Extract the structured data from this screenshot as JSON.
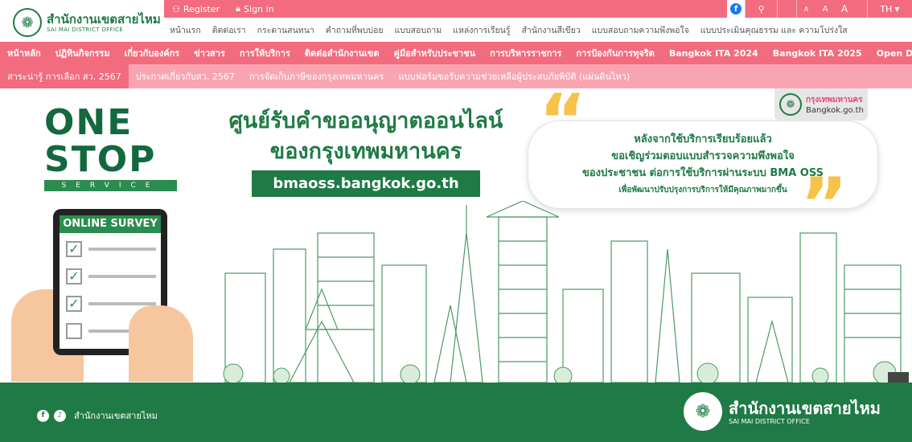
{
  "logo": {
    "seal_icon": "bma-seal-icon",
    "name_th": "สำนักงานเขตสายไหม",
    "name_en": "SAI MAI DISTRICT OFFICE"
  },
  "util_bar": {
    "register": "Register",
    "sign_in": "Sign in",
    "font_sizes": [
      "A",
      "A",
      "A"
    ],
    "language": "TH"
  },
  "secondary_nav": [
    "หน้าแรก",
    "ติดต่อเรา",
    "กระดานสนทนา",
    "คำถามที่พบบ่อย",
    "แบบสอบถาม",
    "แหล่งการเรียนรู้",
    "สำนักงานสีเขียว",
    "แบบสอบถามความพึงพอใจ",
    "แบบประเมินคุณธรรม และ ความโปร่งใส"
  ],
  "main_nav": [
    "หน้าหลัก",
    "ปฏิทินกิจกรรม",
    "เกี่ยวกับองค์กร",
    "ข่าวสาร",
    "การให้บริการ",
    "ติดต่อสำนักงานเขต",
    "คู่มือสำหรับประชาชน",
    "การบริหารราชการ",
    "การป้องกันการทุจริต",
    "Bangkok ITA 2024",
    "Bangkok ITA 2025",
    "Open Data"
  ],
  "sub_nav": [
    "สาระน่ารู้ การเลือก สว. 2567",
    "ประกาศเกี่ยวกับสว. 2567",
    "การจัดเก็บภาษีของกรุงเทพมหานคร",
    "แบบฟอร์มขอรับความช่วยเหลือผู้ประสบภัยพิบัติ (แผ่นดินไหว)"
  ],
  "banner": {
    "one_stop_lines": [
      "ONE",
      "STOP"
    ],
    "one_stop_service": "SERVICE",
    "headline_1": "ศูนย์รับคำขออนุญาตออนไลน์",
    "headline_2": "ของกรุงเทพมหานคร",
    "url": "bmaoss.bangkok.go.th",
    "quote_lines": [
      "หลังจากใช้บริการเรียบร้อยแล้ว",
      "ขอเชิญร่วมตอบแบบสำรวจความพึงพอใจ",
      "ของประชาชน ต่อการใช้บริการผ่านระบบ BMA OSS"
    ],
    "quote_sub": "เพื่อพัฒนาปรับปรุงการบริการให้มีคุณภาพมากขึ้น",
    "tablet_title": "ONLINE SURVEY",
    "bkk_badge_1": "กรุงเทพมหานคร",
    "bkk_badge_2": "Bangkok.go.th"
  },
  "footer": {
    "social_label": "สำนักงานเขตสายไหม",
    "logo_th": "สำนักงานเขตสายไหม",
    "logo_en": "SAI MAI DISTRICT OFFICE"
  },
  "colors": {
    "brand_green": "#1f7a45",
    "nav_pink": "#f26b7e",
    "subnav_pink": "#f9a5b1",
    "accent_yellow": "#f6c24a"
  }
}
